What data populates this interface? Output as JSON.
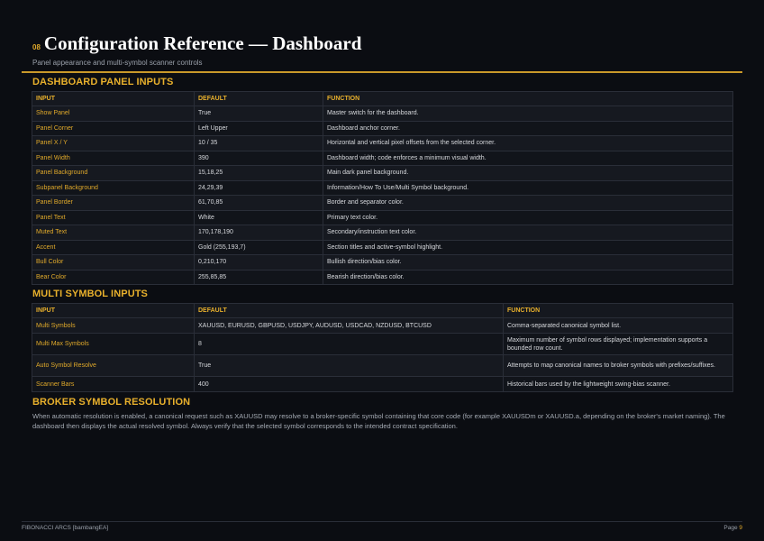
{
  "header": {
    "section_number": "08",
    "title": "Configuration Reference — Dashboard",
    "subtitle": "Panel appearance and multi-symbol scanner controls"
  },
  "dashboard_panel": {
    "heading": "DASHBOARD PANEL INPUTS",
    "columns": [
      "INPUT",
      "DEFAULT",
      "FUNCTION"
    ],
    "rows": [
      {
        "input": "Show Panel",
        "default": "True",
        "function": "Master switch for the dashboard."
      },
      {
        "input": "Panel Corner",
        "default": "Left Upper",
        "function": "Dashboard anchor corner."
      },
      {
        "input": "Panel X / Y",
        "default": "10 / 35",
        "function": "Horizontal and vertical pixel offsets from the selected corner."
      },
      {
        "input": "Panel Width",
        "default": "390",
        "function": "Dashboard width; code enforces a minimum visual width."
      },
      {
        "input": "Panel Background",
        "default": "15,18,25",
        "function": "Main dark panel background."
      },
      {
        "input": "Subpanel Background",
        "default": "24,29,39",
        "function": "Information/How To Use/Multi Symbol background."
      },
      {
        "input": "Panel Border",
        "default": "61,70,85",
        "function": "Border and separator color."
      },
      {
        "input": "Panel Text",
        "default": "White",
        "function": "Primary text color."
      },
      {
        "input": "Muted Text",
        "default": "170,178,190",
        "function": "Secondary/instruction text color."
      },
      {
        "input": "Accent",
        "default": "Gold (255,193,7)",
        "function": "Section titles and active-symbol highlight."
      },
      {
        "input": "Bull Color",
        "default": "0,210,170",
        "function": "Bullish direction/bias color."
      },
      {
        "input": "Bear Color",
        "default": "255,85,85",
        "function": "Bearish direction/bias color."
      }
    ]
  },
  "multi_symbol": {
    "heading": "MULTI SYMBOL INPUTS",
    "columns": [
      "INPUT",
      "DEFAULT",
      "FUNCTION"
    ],
    "rows": [
      {
        "input": "Multi Symbols",
        "default": "XAUUSD, EURUSD, GBPUSD, USDJPY, AUDUSD, USDCAD, NZDUSD, BTCUSD",
        "function": "Comma-separated canonical symbol list."
      },
      {
        "input": "Multi Max Symbols",
        "default": "8",
        "function": "Maximum number of symbol rows displayed; implementation supports a bounded row count."
      },
      {
        "input": "Auto Symbol Resolve",
        "default": "True",
        "function": "Attempts to map canonical names to broker symbols with prefixes/suffixes."
      },
      {
        "input": "Scanner Bars",
        "default": "400",
        "function": "Historical bars used by the lightweight swing-bias scanner."
      }
    ]
  },
  "broker_resolution": {
    "heading": "BROKER SYMBOL RESOLUTION",
    "body": "When automatic resolution is enabled, a canonical request such as XAUUSD may resolve to a broker-specific symbol containing that core code (for example XAUUSDm or XAUUSD.a, depending on the broker's market naming). The dashboard then displays the actual resolved symbol. Always verify that the selected symbol corresponds to the intended contract specification."
  },
  "footer": {
    "left": "FIBONACCI ARCS [bambangEA]",
    "page_label": "Page",
    "page_number": "9"
  },
  "colors": {
    "background": "#0b0d12",
    "accent": "#e8b02c",
    "rule": "#c9992a"
  }
}
